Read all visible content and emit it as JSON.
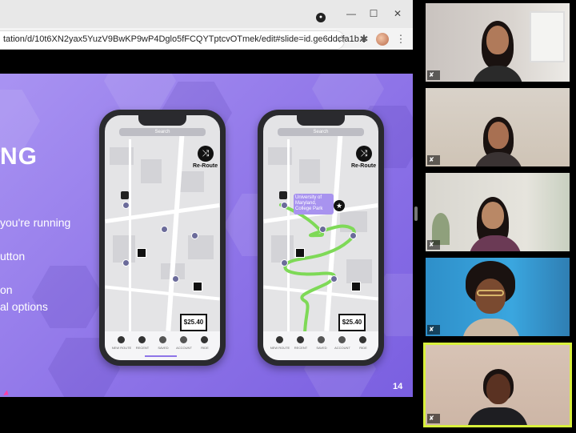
{
  "browser": {
    "url": "tation/d/10t6XN2yax5YuzV9BwKP9wP4Dglo5fFCQYTptcvOTmek/edit#slide=id.ge6ddcfa1b...",
    "icons": [
      "star-icon",
      "extensions-icon",
      "profile-avatar",
      "menu-icon"
    ],
    "window_buttons": [
      "minimize-icon",
      "maximize-icon",
      "close-icon"
    ],
    "glyphs": {
      "minimize": "—",
      "maximize": "☐",
      "close": "✕",
      "star": "☆",
      "extensions": "✱",
      "menu": "⋮",
      "recording": "●"
    }
  },
  "slide": {
    "title": "NG",
    "bullets": [
      "you're running",
      "utton",
      "on",
      "al options"
    ],
    "page_number": "14",
    "colors": {
      "background": "#8e74e8",
      "route": "#7ed957"
    }
  },
  "phones": [
    {
      "search": "Search",
      "reroute_label": "Re-Route",
      "price": "$25.40",
      "nav_labels": [
        "NEW ROUTE",
        "RECENT",
        "SAVED",
        "ACCOUNT",
        "RIDE"
      ]
    },
    {
      "search": "Search",
      "reroute_label": "Re-Route",
      "price": "$25.40",
      "destination": "University of Maryland, College Park",
      "nav_labels": [
        "NEW ROUTE",
        "RECENT",
        "SAVED",
        "ACCOUNT",
        "RIDE"
      ]
    }
  ],
  "participants": [
    {
      "name": "",
      "muted": true,
      "mic_glyph": "✘"
    },
    {
      "name": "",
      "muted": true,
      "mic_glyph": "✘"
    },
    {
      "name": "",
      "muted": true,
      "mic_glyph": "✘"
    },
    {
      "name": "",
      "muted": true,
      "mic_glyph": "✘"
    },
    {
      "name": "",
      "muted": true,
      "mic_glyph": "✘",
      "active": true,
      "highlight_color": "#d8f03c"
    }
  ]
}
